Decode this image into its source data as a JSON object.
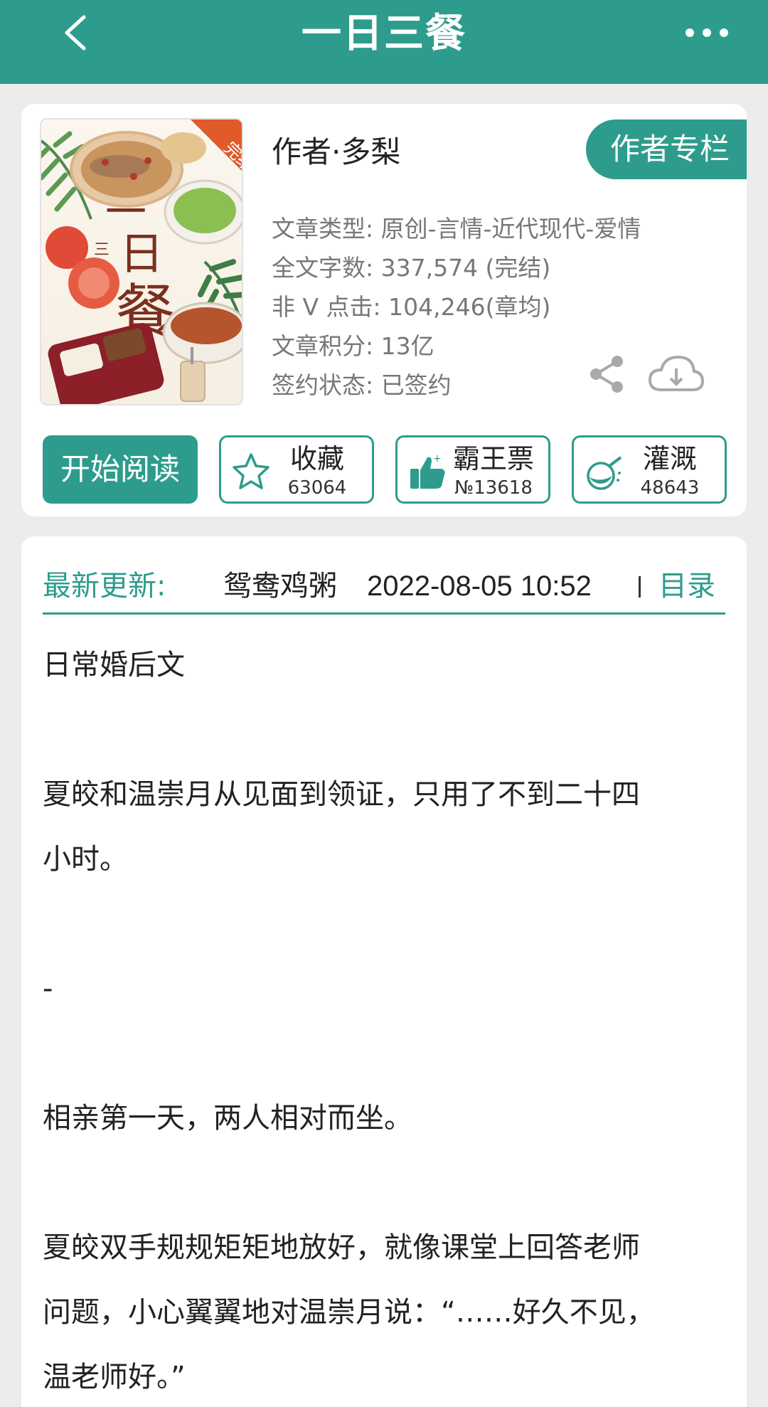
{
  "header": {
    "title": "一日三餐"
  },
  "book": {
    "author_line": "作者·多梨",
    "author_column_button": "作者专栏",
    "cover_badge": "完结",
    "cover_title": "一日三餐",
    "meta": [
      "文章类型: 原创-言情-近代现代-爱情",
      "全文字数: 337,574 (完结)",
      "非 V 点击: 104,246(章均)",
      "文章积分: 13亿",
      "签约状态:  已签约"
    ]
  },
  "actions": {
    "read_label": "开始阅读",
    "favorite": {
      "label": "收藏",
      "count": "63064"
    },
    "vote": {
      "label": "霸王票",
      "count": "№13618"
    },
    "nutrient": {
      "label": "灌溉",
      "count": "48643"
    }
  },
  "latest": {
    "label": "最新更新:",
    "chapter": "鸳鸯鸡粥",
    "time": "2022-08-05 10:52",
    "toc": "目录"
  },
  "summary": [
    "日常婚后文",
    "",
    "夏皎和温崇月从见面到领证，只用了不到二十四",
    "小时。",
    "",
    "-",
    "",
    "相亲第一天，两人相对而坐。",
    "",
    "夏皎双手规规矩矩地放好，就像课堂上回答老师",
    "问题，小心翼翼地对温崇月说：“……好久不见，",
    "温老师好。”"
  ],
  "colors": {
    "accent": "#2e9c8c",
    "background": "#ececec"
  }
}
